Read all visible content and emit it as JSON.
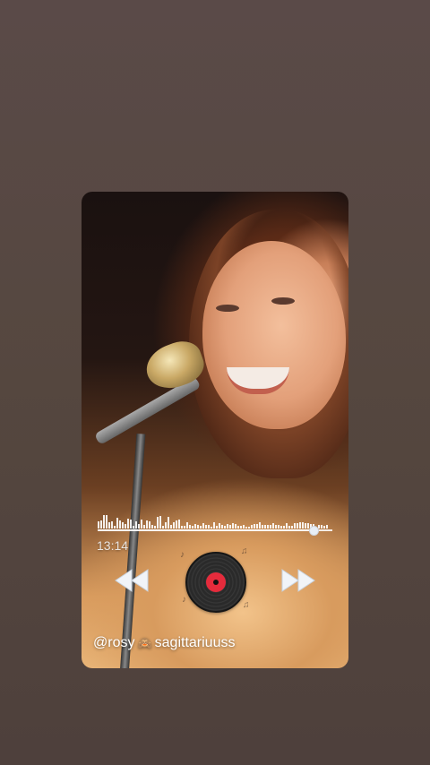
{
  "player": {
    "elapsed_time": "13:14",
    "total_time": "",
    "progress_fraction": 0.92,
    "disc_accent": "#e52b3c",
    "progress_color": "#ffffff"
  },
  "controls": {
    "prev_icon": "rewind-icon",
    "next_icon": "fast-forward-icon",
    "play_icon": "vinyl-record-icon"
  },
  "caption": {
    "username_prefix": "@rosy",
    "emoji": "🙈",
    "username_suffix": "sagittariuuss"
  }
}
